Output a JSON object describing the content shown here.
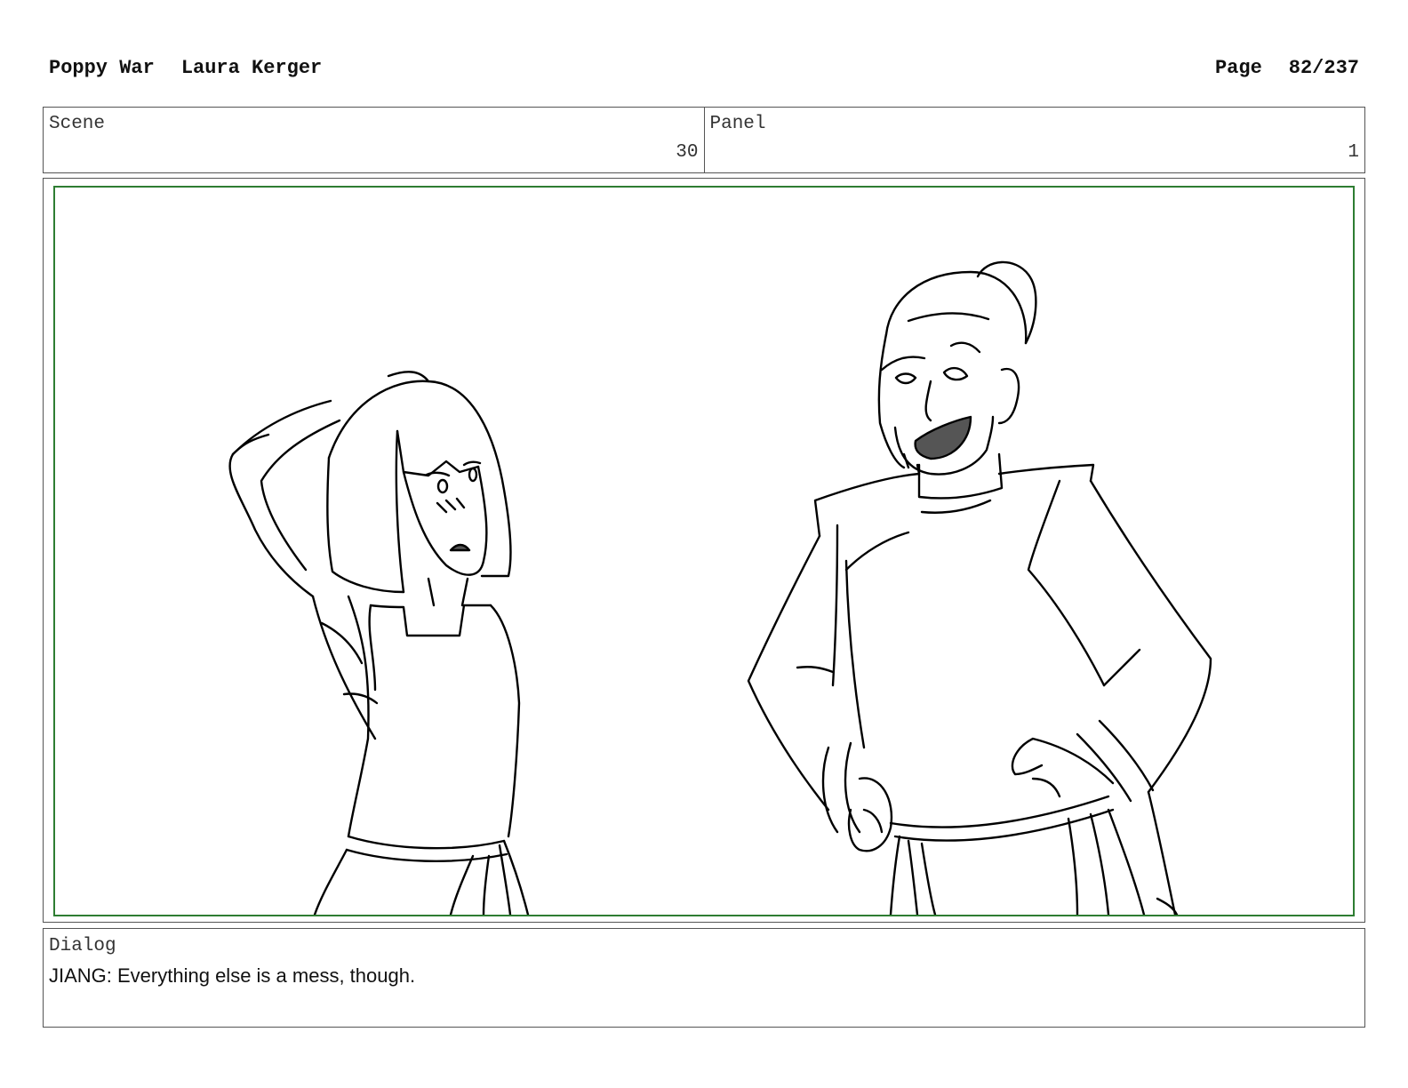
{
  "header": {
    "project": "Poppy War",
    "author": "Laura Kerger",
    "page_label": "Page",
    "page_number": "82/237"
  },
  "scene": {
    "label": "Scene",
    "value": "30"
  },
  "panel": {
    "label": "Panel",
    "value": "1"
  },
  "dialog": {
    "label": "Dialog",
    "text": "JIANG: Everything else is a mess, though."
  },
  "colors": {
    "frame_border": "#2e7d32",
    "box_border": "#555555",
    "ink": "#000000",
    "mouth_fill": "#555555"
  }
}
